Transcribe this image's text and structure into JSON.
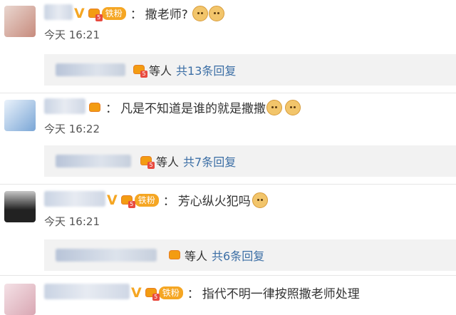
{
  "comments": [
    {
      "badge_level": "5",
      "fan_label": "铁粉",
      "colon": "：",
      "text": "撒老师?",
      "time": "今天 16:21",
      "reply": {
        "badge_level": "5",
        "deng": "等人",
        "count": "共13条回复"
      }
    },
    {
      "badge_level": "",
      "fan_label": "",
      "colon": "：",
      "text": "凡是不知道是谁的就是撒撒",
      "time": "今天 16:22",
      "reply": {
        "badge_level": "5",
        "deng": "等人",
        "count": "共7条回复"
      }
    },
    {
      "badge_level": "5",
      "fan_label": "铁粉",
      "colon": "：",
      "text": "芳心纵火犯吗",
      "time": "今天 16:21",
      "reply": {
        "badge_level": "",
        "deng": "等人",
        "count": "共6条回复"
      }
    },
    {
      "badge_level": "5",
      "fan_label": "铁粉",
      "colon": "：",
      "text": "指代不明一律按照撒老师处理",
      "time": "",
      "reply": null
    }
  ],
  "icons": {
    "verified": "V",
    "crown": "crown-badge-icon",
    "emoji": "doge-emoji-icon"
  },
  "colors": {
    "accent": "#f5a623",
    "link": "#3b6ea5",
    "reply_bg": "#f2f2f2"
  }
}
